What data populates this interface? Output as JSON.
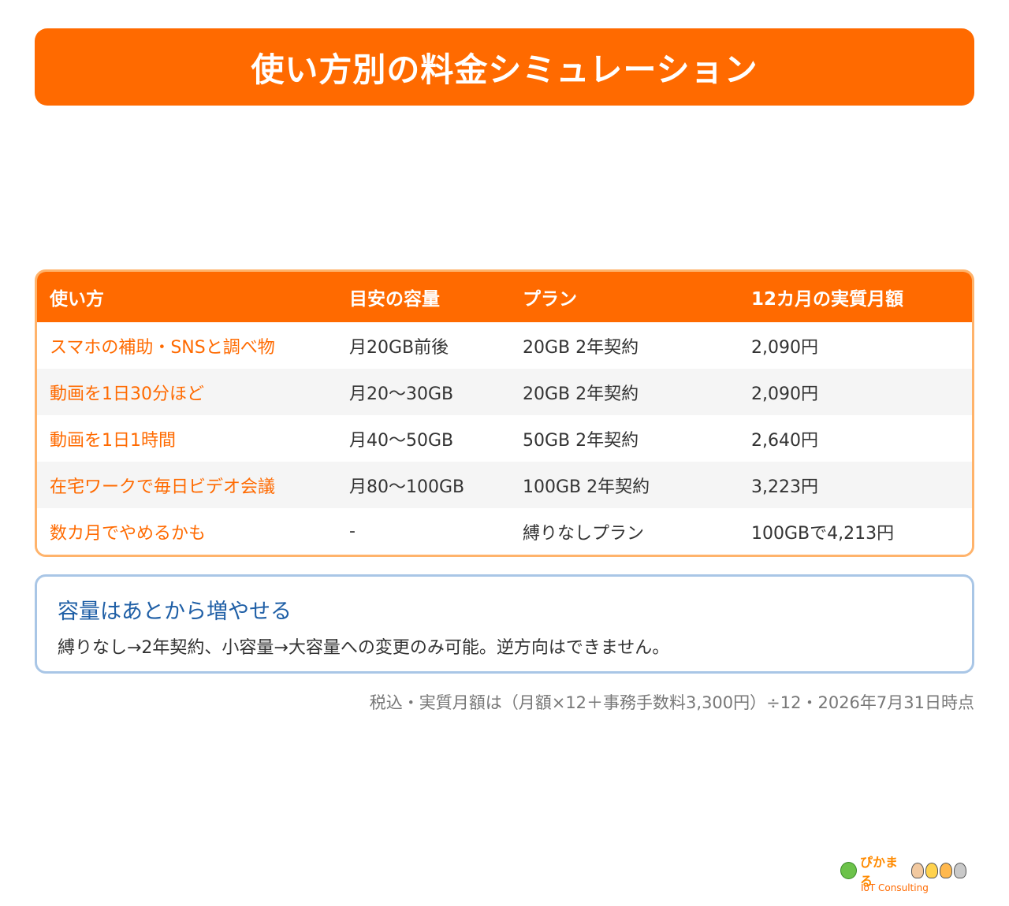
{
  "title": "使い方別の料金シミュレーション",
  "table": {
    "headers": [
      "使い方",
      "目安の容量",
      "プラン",
      "12カ月の実質月額"
    ],
    "rows": [
      {
        "usage": "スマホの補助・SNSと調べ物",
        "capacity": "月20GB前後",
        "plan": "20GB 2年契約",
        "price": "2,090円"
      },
      {
        "usage": "動画を1日30分ほど",
        "capacity": "月20〜30GB",
        "plan": "20GB 2年契約",
        "price": "2,090円"
      },
      {
        "usage": "動画を1日1時間",
        "capacity": "月40〜50GB",
        "plan": "50GB 2年契約",
        "price": "2,640円"
      },
      {
        "usage": "在宅ワークで毎日ビデオ会議",
        "capacity": "月80〜100GB",
        "plan": "100GB 2年契約",
        "price": "3,223円"
      },
      {
        "usage": "数カ月でやめるかも",
        "capacity": "-",
        "plan": "縛りなしプラン",
        "price": "100GBで4,213円"
      }
    ]
  },
  "note": {
    "title": "容量はあとから増やせる",
    "body": "縛りなし→2年契約、小容量→大容量への変更のみ可能。逆方向はできません。"
  },
  "footnote": "税込・実質月額は（月額×12＋事務手数料3,300円）÷12・2026年7月31日時点",
  "logo": {
    "name": "ぴかまる",
    "subtitle": "IoT Consulting"
  },
  "colors": {
    "accent": "#ff6a00",
    "table_border": "#ffb36b",
    "note_border": "#a9c6e6",
    "note_title": "#1f5fa6"
  }
}
